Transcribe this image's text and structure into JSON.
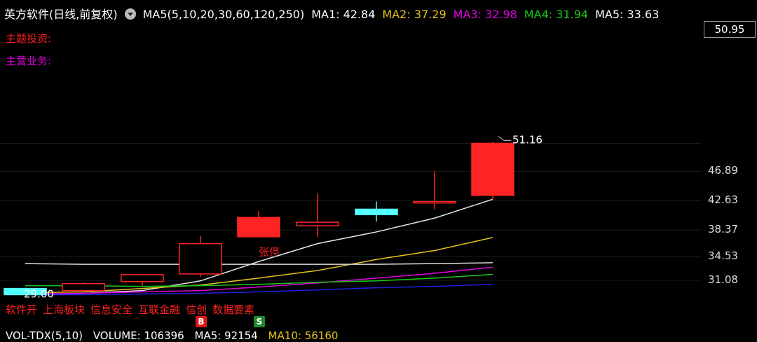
{
  "header": {
    "stock_name": "英方软件(日线,前复权)",
    "ma_config": "MA5(5,10,20,30,60,120,250)",
    "ma_values": [
      {
        "label": "MA1: 42.84",
        "color": "#ffffff"
      },
      {
        "label": "MA2: 37.29",
        "color": "#e6c21c"
      },
      {
        "label": "MA3: 32.98",
        "color": "#e000e0"
      },
      {
        "label": "MA4: 31.94",
        "color": "#18c818"
      },
      {
        "label": "MA5: 33.63",
        "color": "#ffffff"
      }
    ]
  },
  "side_labels": {
    "theme": "主题投资:",
    "business": "主营业务:"
  },
  "price_axis": {
    "top_box": "50.95",
    "ticks": [
      "46.89",
      "42.63",
      "38.37",
      "34.53",
      "31.08"
    ]
  },
  "annotations": {
    "high_label": "51.16",
    "limit_up": "张停",
    "low_label": "29.00"
  },
  "concepts": [
    "软件开",
    "上海板块",
    "信息安全",
    "互联金融",
    "信创",
    "数据要素"
  ],
  "signals": {
    "b": "B",
    "s": "S"
  },
  "volume_bar": {
    "title": "VOL-TDX(5,10)",
    "volume": "VOLUME: 106396",
    "ma5": "MA5: 92154",
    "ma10": "MA10: 56160",
    "ma10_color": "#e6c21c"
  },
  "chart_data": {
    "type": "candlestick",
    "y_axis_ticks": [
      31.08,
      34.53,
      38.37,
      42.63,
      46.89,
      50.95
    ],
    "candles": [
      {
        "open": 29.9,
        "close": 29.0,
        "high": 30.0,
        "low": 28.9,
        "color": "cyan"
      },
      {
        "open": 29.6,
        "close": 30.6,
        "high": 30.8,
        "low": 29.4,
        "color": "red"
      },
      {
        "open": 30.9,
        "close": 31.9,
        "high": 32.0,
        "low": 30.3,
        "color": "red"
      },
      {
        "open": 32.0,
        "close": 36.4,
        "high": 37.5,
        "low": 31.6,
        "color": "red"
      },
      {
        "open": 37.4,
        "close": 40.2,
        "high": 41.1,
        "low": 37.3,
        "color": "red_filled"
      },
      {
        "open": 39.5,
        "close": 39.0,
        "high": 43.7,
        "low": 37.4,
        "color": "red"
      },
      {
        "open": 41.4,
        "close": 40.6,
        "high": 42.5,
        "low": 39.6,
        "color": "cyan"
      },
      {
        "open": 42.3,
        "close": 42.5,
        "high": 46.9,
        "low": 41.4,
        "color": "red"
      },
      {
        "open": 43.4,
        "close": 50.95,
        "high": 51.16,
        "low": 42.8,
        "color": "red_filled"
      }
    ],
    "ma_lines": [
      {
        "name": "MA1",
        "color": "#e8e8e8",
        "values": [
          29.0,
          29.2,
          29.6,
          31.0,
          33.8,
          36.4,
          38.1,
          40.1,
          42.84
        ]
      },
      {
        "name": "MA2",
        "color": "#e6c21c",
        "values": [
          29.3,
          29.4,
          29.9,
          30.4,
          31.4,
          32.5,
          34.1,
          35.4,
          37.29
        ]
      },
      {
        "name": "MA3",
        "color": "#e000e0",
        "values": [
          29.1,
          29.2,
          29.4,
          29.6,
          30.1,
          30.7,
          31.4,
          32.1,
          32.98
        ]
      },
      {
        "name": "MA4",
        "color": "#18c818",
        "values": [
          30.3,
          30.3,
          30.2,
          30.3,
          30.5,
          30.8,
          31.0,
          31.4,
          31.94
        ]
      },
      {
        "name": "MA5",
        "color": "#dddddd",
        "values": [
          33.5,
          33.4,
          33.4,
          33.4,
          33.4,
          33.4,
          33.4,
          33.5,
          33.63
        ]
      },
      {
        "name": "MA6",
        "color": "#2020e0",
        "values": [
          29.0,
          29.0,
          29.1,
          29.2,
          29.4,
          29.7,
          30.0,
          30.2,
          30.5
        ]
      }
    ]
  }
}
